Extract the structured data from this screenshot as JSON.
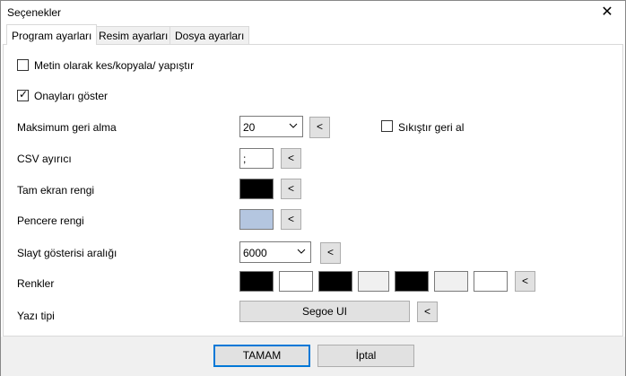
{
  "window": {
    "title": "Seçenekler",
    "close_icon": "close-icon"
  },
  "tabs": [
    {
      "label": "Program ayarları",
      "active": true
    },
    {
      "label": "Resim ayarları",
      "active": false
    },
    {
      "label": "Dosya ayarları",
      "active": false
    }
  ],
  "options": {
    "cut_copy_paste_text": {
      "label": "Metin olarak kes/kopyala/ yapıştır",
      "checked": false
    },
    "show_confirmations": {
      "label": "Onayları göster",
      "checked": true,
      "check_mark": "✓"
    },
    "max_undo": {
      "label": "Maksimum geri alma",
      "value": "20",
      "reset_label": "<"
    },
    "compress_undo": {
      "label": "Sıkıştır geri al",
      "checked": false
    },
    "csv_separator": {
      "label": "CSV ayırıcı",
      "value": ";",
      "reset_label": "<"
    },
    "fullscreen_color": {
      "label": "Tam ekran rengi",
      "color": "#000000",
      "reset_label": "<"
    },
    "window_color": {
      "label": "Pencere rengi",
      "color": "#b4c6e0",
      "reset_label": "<"
    },
    "slideshow_interval": {
      "label": "Slayt gösterisi aralığı",
      "value": "6000",
      "reset_label": "<"
    },
    "colors": {
      "label": "Renkler",
      "swatches": [
        "#000000",
        "#ffffff",
        "#000000",
        "#f0f0f0",
        "#000000",
        "#f0f0f0",
        "#ffffff"
      ],
      "reset_label": "<"
    },
    "font": {
      "label": "Yazı tipi",
      "value": "Segoe UI",
      "reset_label": "<"
    }
  },
  "footer": {
    "ok_label": "TAMAM",
    "cancel_label": "İptal"
  }
}
